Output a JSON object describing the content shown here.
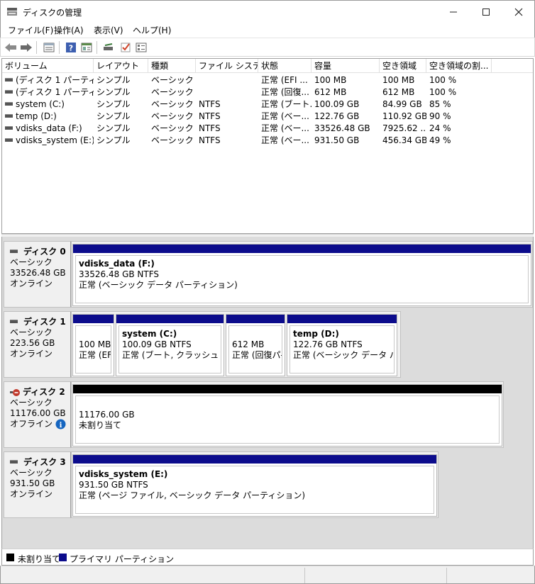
{
  "window": {
    "title": "ディスクの管理"
  },
  "menu": [
    "ファイル(F)",
    "操作(A)",
    "表示(V)",
    "ヘルプ(H)"
  ],
  "toolbar": [
    "back-arrow-icon",
    "forward-arrow-icon",
    "list-view-icon",
    "help-icon",
    "properties-icon",
    "rescan-disks-icon",
    "check-icon",
    "settings-list-icon"
  ],
  "volumes": {
    "columns": [
      "ボリューム",
      "レイアウト",
      "種類",
      "ファイル システム",
      "状態",
      "容量",
      "空き領域",
      "空き領域の割..."
    ],
    "rows": [
      [
        "(ディスク 1 パーティシ...",
        "シンプル",
        "ベーシック",
        "",
        "正常 (EFI ...",
        "100 MB",
        "100 MB",
        "100 %"
      ],
      [
        "(ディスク 1 パーティシ...",
        "シンプル",
        "ベーシック",
        "",
        "正常 (回復...",
        "612 MB",
        "612 MB",
        "100 %"
      ],
      [
        "system (C:)",
        "シンプル",
        "ベーシック",
        "NTFS",
        "正常 (ブート...",
        "100.09 GB",
        "84.99 GB",
        "85 %"
      ],
      [
        "temp (D:)",
        "シンプル",
        "ベーシック",
        "NTFS",
        "正常 (ベー...",
        "122.76 GB",
        "110.92 GB",
        "90 %"
      ],
      [
        "vdisks_data (F:)",
        "シンプル",
        "ベーシック",
        "NTFS",
        "正常 (ベー...",
        "33526.48 GB",
        "7925.62 ...",
        "24 %"
      ],
      [
        "vdisks_system (E:)",
        "シンプル",
        "ベーシック",
        "NTFS",
        "正常 (ベー...",
        "931.50 GB",
        "456.34 GB",
        "49 %"
      ]
    ]
  },
  "disks": [
    {
      "name": "ディスク 0",
      "type": "ベーシック",
      "size": "33526.48 GB",
      "status": "オンライン",
      "partitions": [
        {
          "name": "vdisks_data  (F:)",
          "size": "33526.48 GB NTFS",
          "status": "正常 (ベーシック データ パーティション)"
        }
      ]
    },
    {
      "name": "ディスク 1",
      "type": "ベーシック",
      "size": "223.56 GB",
      "status": "オンライン",
      "partitions": [
        {
          "name": "",
          "size": "100 MB",
          "status": "正常 (EFI"
        },
        {
          "name": "system  (C:)",
          "size": "100.09 GB NTFS",
          "status": "正常 (ブート, クラッシュ ダンプ,"
        },
        {
          "name": "",
          "size": "612 MB",
          "status": "正常 (回復パ-"
        },
        {
          "name": "temp  (D:)",
          "size": "122.76 GB NTFS",
          "status": "正常 (ベーシック データ パーティ"
        }
      ]
    },
    {
      "name": "ディスク 2",
      "type": "ベーシック",
      "size": "11176.00 GB",
      "status": "オフライン",
      "partitions": [
        {
          "name": "",
          "size": "11176.00 GB",
          "status": "未割り当て"
        }
      ]
    },
    {
      "name": "ディスク 3",
      "type": "ベーシック",
      "size": "931.50 GB",
      "status": "オンライン",
      "partitions": [
        {
          "name": "vdisks_system  (E:)",
          "size": "931.50 GB NTFS",
          "status": "正常 (ページ ファイル, ベーシック データ パーティション)"
        }
      ]
    }
  ],
  "legend": [
    {
      "label": "未割り当て",
      "color": "#000000"
    },
    {
      "label": "プライマリ パーティション",
      "color": "#0c0c8c"
    }
  ],
  "colors": {
    "primary_partition": "#0c0c8c",
    "unallocated": "#000000",
    "offline_badge": "#c0392b",
    "info_badge": "#1565c0"
  }
}
